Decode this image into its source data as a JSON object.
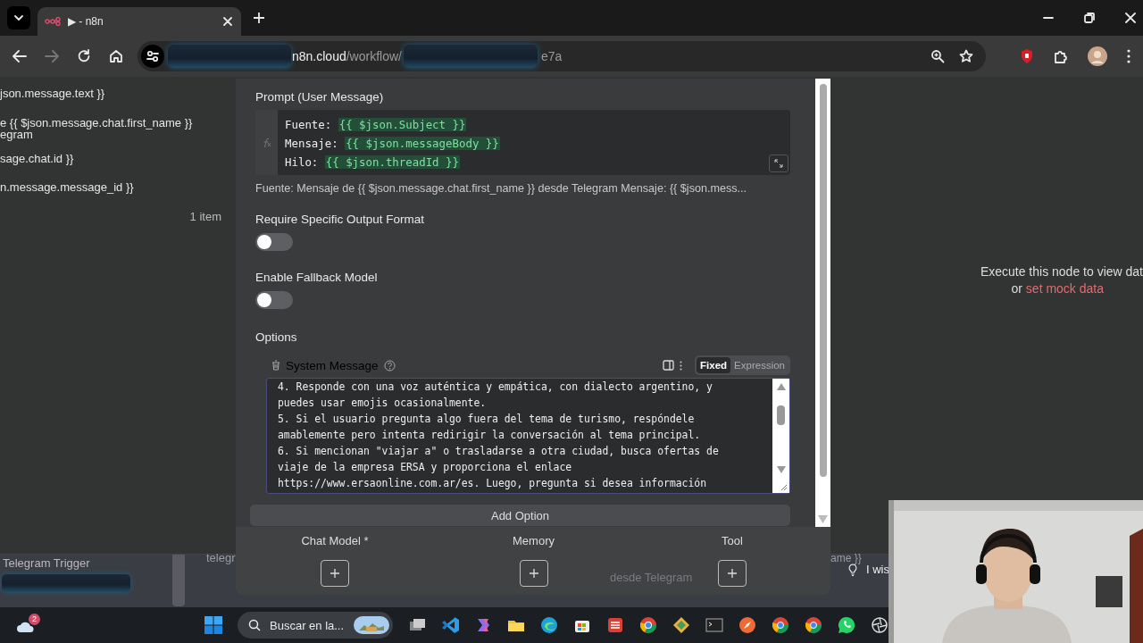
{
  "browser": {
    "tab": {
      "title": "▶ - n8n"
    },
    "address": {
      "domain": "n8n.cloud",
      "path": "/workflow/",
      "suffix": "e7a"
    }
  },
  "input_panel": {
    "lines": [
      "json.message.text }}",
      "e {{ $json.message.chat.first_name }}",
      "egram",
      "sage.chat.id }}",
      "n.message.message_id }}"
    ],
    "item_count": "1 item"
  },
  "node_settings": {
    "prompt": {
      "label": "Prompt (User Message)",
      "lines": [
        {
          "label": "Fuente: ",
          "expression": "{{ $json.Subject }}"
        },
        {
          "label": "Mensaje: ",
          "expression": "{{ $json.messageBody }}"
        },
        {
          "label": "Hilo: ",
          "expression": "{{ $json.threadId }}"
        }
      ],
      "preview": "Fuente: Mensaje de {{ $json.message.chat.first_name }} desde Telegram Mensaje: {{ $json.mess..."
    },
    "toggles": [
      {
        "label": "Require Specific Output Format",
        "on": false
      },
      {
        "label": "Enable Fallback Model",
        "on": false
      }
    ],
    "options_heading": "Options",
    "system_message": {
      "label": "System Message",
      "modes": [
        {
          "label": "Fixed",
          "selected": true
        },
        {
          "label": "Expression",
          "selected": false
        }
      ],
      "lines": [
        "4. Responde con una voz auténtica y empática, con dialecto argentino, y",
        "puedes usar emojis ocasionalmente.",
        "5. Si el usuario pregunta algo fuera del tema de turismo, respóndele",
        "amablemente pero intenta redirigir la conversación al tema principal.",
        "6. Si mencionan \"viajar a\" o trasladarse a otra ciudad, busca ofertas de",
        "viaje de la empresa ERSA y proporciona el enlace",
        "https://www.ersaonline.com.ar/es. Luego, pregunta si desea información"
      ]
    },
    "add_option": "Add Option",
    "connectors": [
      {
        "label": "Chat Model *"
      },
      {
        "label": "Memory"
      },
      {
        "label": "Tool"
      }
    ]
  },
  "output_panel": {
    "message": "Execute this node to view dat",
    "prefix": "or ",
    "link": "set mock data"
  },
  "canvas": {
    "labels": [
      "Telegram Trigger",
      "telegr",
      "desde Telegram",
      "ame }}",
      "I wis"
    ]
  },
  "taskbar": {
    "weather_badge": "2",
    "search": {
      "placeholder": "Buscar en la..."
    }
  }
}
